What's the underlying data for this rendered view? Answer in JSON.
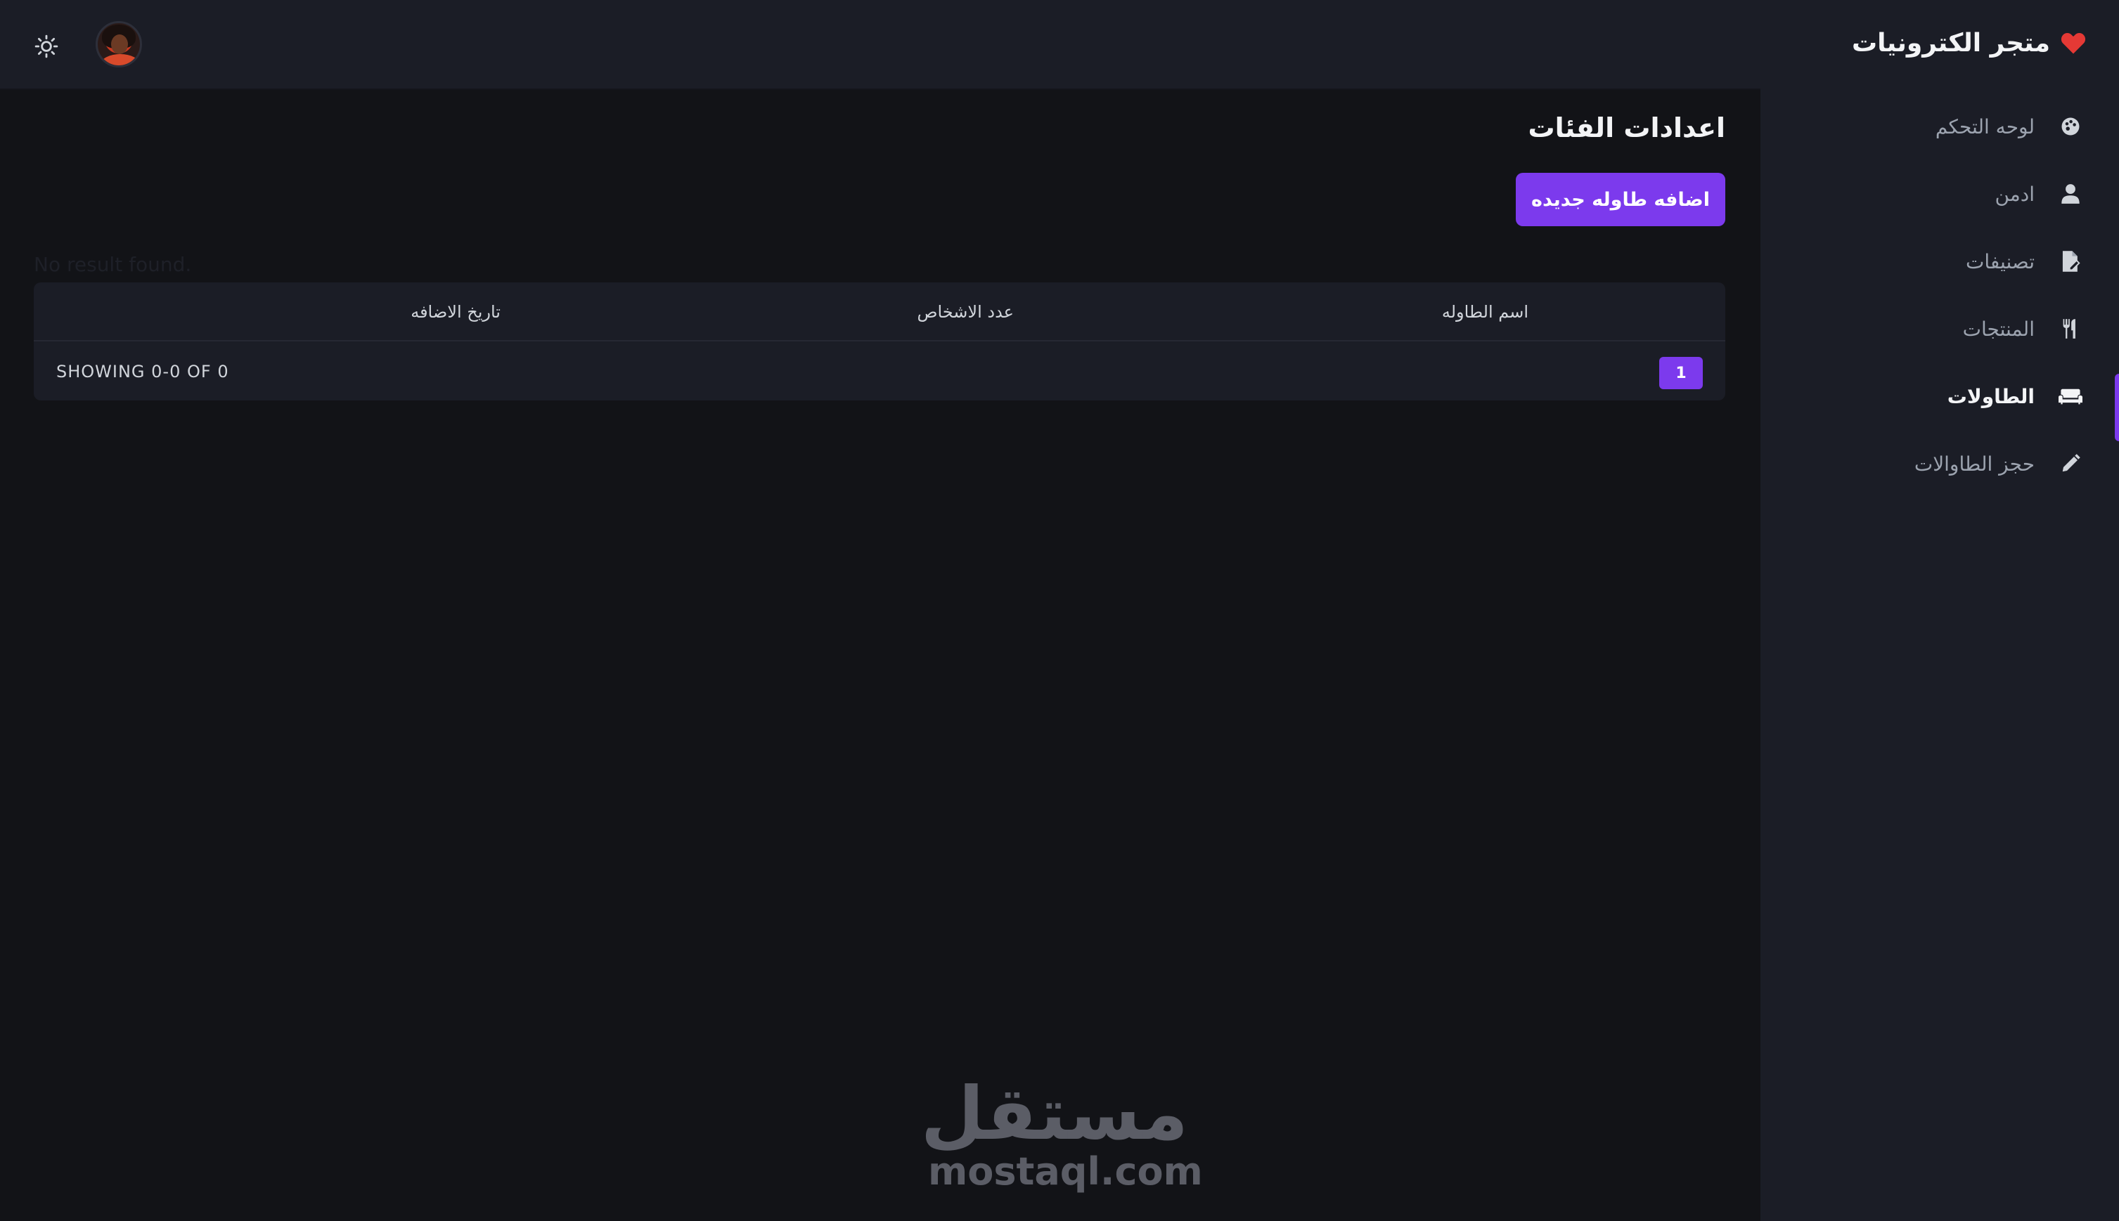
{
  "brand": {
    "name": "متجر الكترونيات",
    "icon": "heart-icon",
    "icon_color": "#e53935"
  },
  "sidebar": {
    "items": [
      {
        "label": "لوحه التحكم",
        "icon": "palette-icon",
        "active": false
      },
      {
        "label": "ادمن",
        "icon": "user-icon",
        "active": false
      },
      {
        "label": "تصنيفات",
        "icon": "file-edit-icon",
        "active": false
      },
      {
        "label": "المنتجات",
        "icon": "utensils-icon",
        "active": false
      },
      {
        "label": "الطاولات",
        "icon": "couch-icon",
        "active": true
      },
      {
        "label": "حجز الطاوالات",
        "icon": "pencil-icon",
        "active": false
      }
    ]
  },
  "header": {
    "theme_icon": "sun-icon",
    "avatar_icon": "avatar"
  },
  "main": {
    "title": "اعدادات الفئات",
    "add_button": "اضافه طاوله جديده",
    "empty_text": "No result found.",
    "table": {
      "columns": [
        "اسم الطاوله",
        "عدد الاشخاص",
        "تاريخ الاضافه"
      ],
      "rows": [],
      "showing": "SHOWING 0-0 OF 0",
      "current_page": "1"
    }
  },
  "watermark": {
    "arabic": "مستقل",
    "latin": "mostaql.com"
  },
  "colors": {
    "accent": "#7c3aed",
    "background": "#121317",
    "panel": "#1b1d26"
  }
}
